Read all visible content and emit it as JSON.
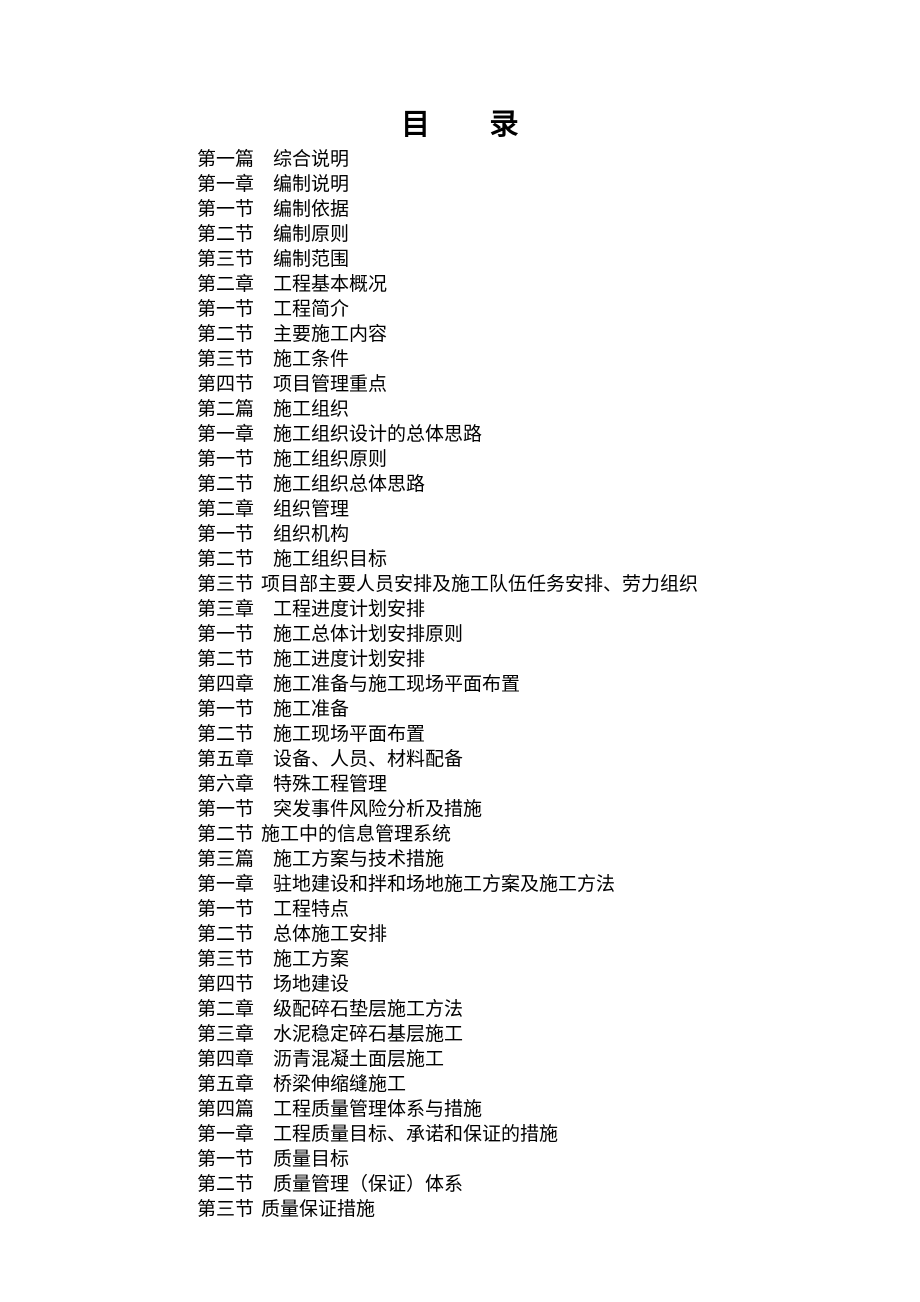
{
  "document": {
    "title": "目　　录",
    "title_plain": "目录"
  },
  "toc": {
    "entries": [
      {
        "label": "第一篇",
        "title": "综合说明",
        "tight": false
      },
      {
        "label": "第一章",
        "title": "编制说明",
        "tight": false
      },
      {
        "label": "第一节",
        "title": "编制依据",
        "tight": false
      },
      {
        "label": "第二节",
        "title": "编制原则",
        "tight": false
      },
      {
        "label": "第三节",
        "title": "编制范围",
        "tight": false
      },
      {
        "label": "第二章",
        "title": "工程基本概况",
        "tight": false
      },
      {
        "label": "第一节",
        "title": "工程简介",
        "tight": false
      },
      {
        "label": "第二节",
        "title": "主要施工内容",
        "tight": false
      },
      {
        "label": "第三节",
        "title": "施工条件",
        "tight": false
      },
      {
        "label": "第四节",
        "title": "项目管理重点",
        "tight": false
      },
      {
        "label": "第二篇",
        "title": "施工组织",
        "tight": false
      },
      {
        "label": "第一章",
        "title": "施工组织设计的总体思路",
        "tight": false
      },
      {
        "label": "第一节",
        "title": "施工组织原则",
        "tight": false
      },
      {
        "label": "第二节",
        "title": "施工组织总体思路",
        "tight": false
      },
      {
        "label": "第二章",
        "title": "组织管理",
        "tight": false
      },
      {
        "label": "第一节",
        "title": "组织机构",
        "tight": false
      },
      {
        "label": "第二节",
        "title": "施工组织目标",
        "tight": false
      },
      {
        "label": "第三节",
        "title": "项目部主要人员安排及施工队伍任务安排、劳力组织",
        "tight": true
      },
      {
        "label": "第三章",
        "title": "工程进度计划安排",
        "tight": false
      },
      {
        "label": "第一节",
        "title": "施工总体计划安排原则",
        "tight": false
      },
      {
        "label": "第二节",
        "title": "施工进度计划安排",
        "tight": false
      },
      {
        "label": "第四章",
        "title": "施工准备与施工现场平面布置",
        "tight": false
      },
      {
        "label": "第一节",
        "title": "施工准备",
        "tight": false
      },
      {
        "label": "第二节",
        "title": "施工现场平面布置",
        "tight": false
      },
      {
        "label": "第五章",
        "title": "设备、人员、材料配备",
        "tight": false
      },
      {
        "label": "第六章",
        "title": "特殊工程管理",
        "tight": false
      },
      {
        "label": "第一节",
        "title": "突发事件风险分析及措施",
        "tight": false
      },
      {
        "label": "第二节",
        "title": "施工中的信息管理系统",
        "tight": true
      },
      {
        "label": "第三篇",
        "title": "施工方案与技术措施",
        "tight": false
      },
      {
        "label": "第一章",
        "title": "驻地建设和拌和场地施工方案及施工方法",
        "tight": false
      },
      {
        "label": "第一节",
        "title": "工程特点",
        "tight": false
      },
      {
        "label": "第二节",
        "title": "总体施工安排",
        "tight": false
      },
      {
        "label": "第三节",
        "title": "施工方案",
        "tight": false
      },
      {
        "label": "第四节",
        "title": "场地建设",
        "tight": false
      },
      {
        "label": "第二章",
        "title": "级配碎石垫层施工方法",
        "tight": false
      },
      {
        "label": "第三章",
        "title": "水泥稳定碎石基层施工",
        "tight": false
      },
      {
        "label": "第四章",
        "title": "沥青混凝土面层施工",
        "tight": false
      },
      {
        "label": "第五章",
        "title": "桥梁伸缩缝施工",
        "tight": false
      },
      {
        "label": "第四篇",
        "title": "工程质量管理体系与措施",
        "tight": false
      },
      {
        "label": "第一章",
        "title": "工程质量目标、承诺和保证的措施",
        "tight": false
      },
      {
        "label": "第一节",
        "title": "质量目标",
        "tight": false
      },
      {
        "label": "第二节",
        "title": "质量管理（保证）体系",
        "tight": false
      },
      {
        "label": "第三节",
        "title": "质量保证措施",
        "tight": true
      }
    ]
  }
}
